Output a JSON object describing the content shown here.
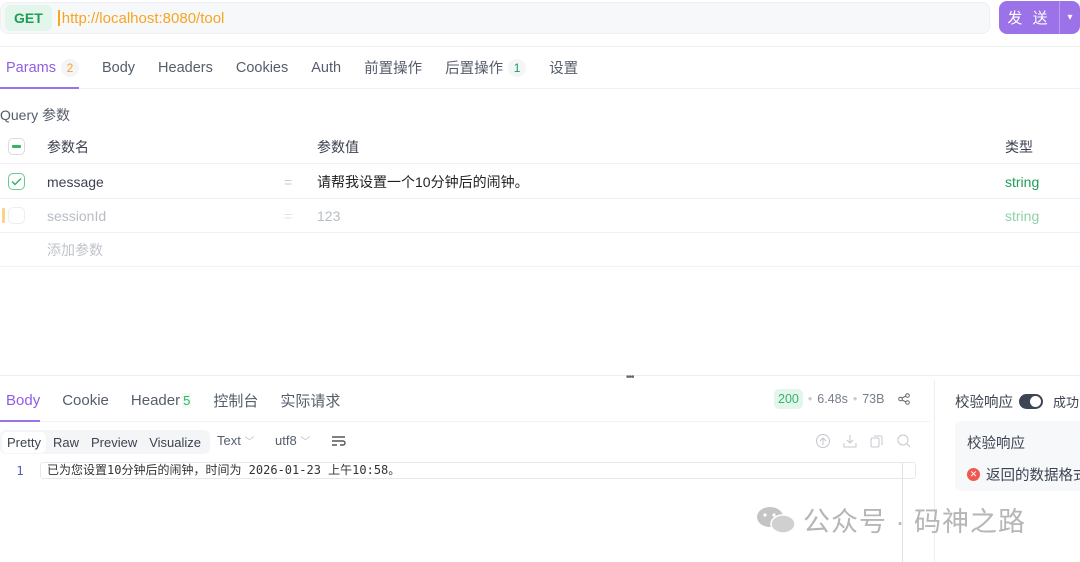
{
  "request": {
    "method": "GET",
    "url": "http://localhost:8080/tool",
    "send_label": "发 送"
  },
  "tabs": [
    {
      "label": "Params",
      "badge": "2"
    },
    {
      "label": "Body"
    },
    {
      "label": "Headers"
    },
    {
      "label": "Cookies"
    },
    {
      "label": "Auth"
    },
    {
      "label": "前置操作"
    },
    {
      "label": "后置操作",
      "badge": "1"
    },
    {
      "label": "设置"
    }
  ],
  "query": {
    "title": "Query 参数",
    "headers": {
      "name": "参数名",
      "value": "参数值",
      "type": "类型"
    },
    "rows": [
      {
        "name": "message",
        "value": "请帮我设置一个10分钟后的闹钟。",
        "type": "string",
        "checked": true
      },
      {
        "name": "sessionId",
        "value": "123",
        "type": "string",
        "checked": false
      }
    ],
    "add_placeholder": "添加参数",
    "eq": "="
  },
  "response": {
    "tabs": [
      {
        "label": "Body"
      },
      {
        "label": "Cookie"
      },
      {
        "label": "Header",
        "badge": "5"
      },
      {
        "label": "控制台"
      },
      {
        "label": "实际请求"
      }
    ],
    "status": "200",
    "time": "6.48s",
    "size": "73B",
    "views": [
      "Pretty",
      "Raw",
      "Preview",
      "Visualize"
    ],
    "format": "Text",
    "encoding": "utf8",
    "lines": [
      {
        "num": "1",
        "text": "已为您设置10分钟后的闹钟，时间为 2026-01-23 上午10:58。"
      }
    ]
  },
  "verify": {
    "label": "校验响应",
    "status": "成功",
    "panel_title": "校验响应",
    "error": "返回的数据格式"
  },
  "watermark": "公众号 · 码神之路"
}
